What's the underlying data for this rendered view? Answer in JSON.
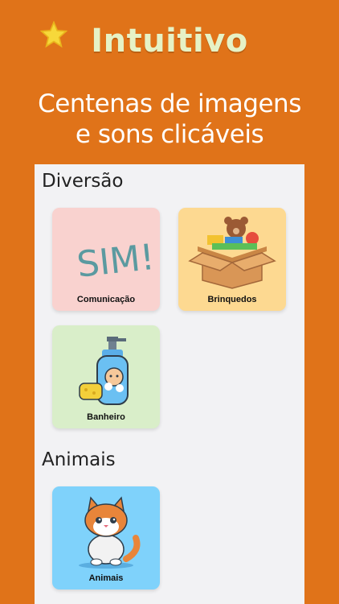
{
  "headline": "Intuitivo",
  "subtitle": [
    "Centenas de imagens",
    "e sons clicáveis"
  ],
  "colors": {
    "background": "#e07319",
    "headline": "#e6f2c6",
    "panel": "#f2f2f4"
  },
  "sections": [
    {
      "title": "Diversão",
      "cards": [
        {
          "label": "Comunicação",
          "image_text": "SIM!",
          "icon": "sim-text-icon",
          "bg": "#f9d2cf"
        },
        {
          "label": "Brinquedos",
          "icon": "toy-box-icon",
          "bg": "#fdd991"
        },
        {
          "label": "Banheiro",
          "icon": "soap-bottle-icon",
          "bg": "#d9eec9"
        }
      ]
    },
    {
      "title": "Animais",
      "cards": [
        {
          "label": "Animais",
          "icon": "cat-icon",
          "bg": "#7fd2fb"
        }
      ]
    }
  ]
}
